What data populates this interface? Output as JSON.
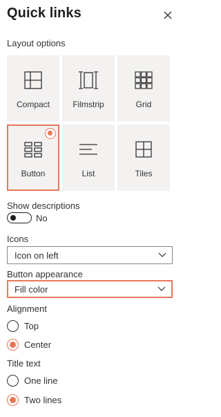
{
  "panel": {
    "title": "Quick links",
    "close_icon": "close-icon"
  },
  "layout": {
    "label": "Layout options",
    "options": [
      {
        "label": "Compact",
        "icon": "compact-layout-icon",
        "selected": false
      },
      {
        "label": "Filmstrip",
        "icon": "filmstrip-layout-icon",
        "selected": false
      },
      {
        "label": "Grid",
        "icon": "grid-layout-icon",
        "selected": false
      },
      {
        "label": "Button",
        "icon": "button-layout-icon",
        "selected": true
      },
      {
        "label": "List",
        "icon": "list-layout-icon",
        "selected": false
      },
      {
        "label": "Tiles",
        "icon": "tiles-layout-icon",
        "selected": false
      }
    ]
  },
  "show_descriptions": {
    "label": "Show descriptions",
    "value": "No",
    "on": false
  },
  "icons": {
    "label": "Icons",
    "value": "Icon on left"
  },
  "button_appearance": {
    "label": "Button appearance",
    "value": "Fill color"
  },
  "alignment": {
    "label": "Alignment",
    "options": [
      {
        "label": "Top",
        "checked": false
      },
      {
        "label": "Center",
        "checked": true
      }
    ]
  },
  "title_text": {
    "label": "Title text",
    "options": [
      {
        "label": "One line",
        "checked": false
      },
      {
        "label": "Two lines",
        "checked": true
      }
    ]
  },
  "colors": {
    "accent": "#e8775a",
    "tile_bg": "#f3f2f1",
    "text": "#323130"
  }
}
